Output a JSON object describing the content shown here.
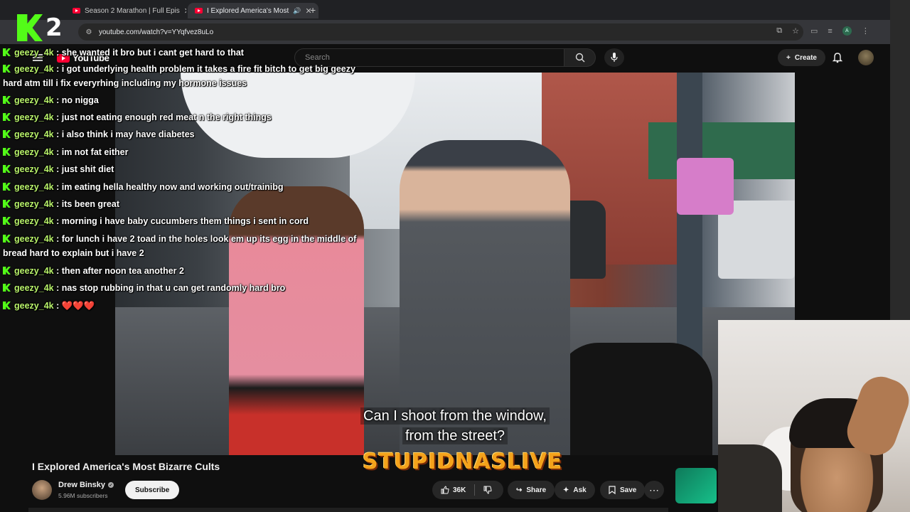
{
  "browser": {
    "tabs": [
      {
        "label": "Season 2 Marathon | Full Epis",
        "active": false
      },
      {
        "label": "I Explored America's Most",
        "active": true
      }
    ],
    "new_tab_glyph": "+",
    "url": "youtube.com/watch?v=YYqfvez8uLo"
  },
  "overlay_logo": {
    "number": "2",
    "brand_color": "#53fc18"
  },
  "youtube": {
    "logo_text": "YouTube",
    "search_placeholder": "Search",
    "create_label": "Create"
  },
  "chat": {
    "messages": [
      {
        "user": "geezy_4k",
        "text": "she wanted it bro but i cant get hard to that"
      },
      {
        "user": "geezy_4k",
        "text": "i got underlying health problem it takes a fire fit bitch to get big geezy hard atm till i fix everyrhing including my hormone issues"
      },
      {
        "user": "geezy_4k",
        "text": "no nigga"
      },
      {
        "user": "geezy_4k",
        "text": "just not eating enough red meat n the right things"
      },
      {
        "user": "geezy_4k",
        "text": "i also think i may have diabetes"
      },
      {
        "user": "geezy_4k",
        "text": "im not fat either"
      },
      {
        "user": "geezy_4k",
        "text": "just shit diet"
      },
      {
        "user": "geezy_4k",
        "text": "im eating hella healthy now and working out/trainibg"
      },
      {
        "user": "geezy_4k",
        "text": "its been great"
      },
      {
        "user": "geezy_4k",
        "text": "morning i have baby cucumbers them things i sent in cord"
      },
      {
        "user": "geezy_4k",
        "text": "for lunch i have 2 toad in the holes look em up its egg in the middle of bread hard to explain but i have 2"
      },
      {
        "user": "geezy_4k",
        "text": "then after noon tea another 2"
      },
      {
        "user": "geezy_4k",
        "text": "nas stop rubbing in that u can get randomly hard bro"
      },
      {
        "user": "geezy_4k",
        "text": "❤️❤️❤️"
      }
    ]
  },
  "video": {
    "caption_line1": "Can I shoot from the window,",
    "caption_line2": "from the street?",
    "stream_logo_text": "STUPIDNASLIVE",
    "title": "I Explored America's Most Bizarre Cults"
  },
  "channel": {
    "name": "Drew Binsky",
    "subscribers": "5.96M subscribers",
    "subscribe_label": "Subscribe"
  },
  "actions": {
    "likes": "36K",
    "share_label": "Share",
    "ask_label": "Ask",
    "save_label": "Save"
  }
}
